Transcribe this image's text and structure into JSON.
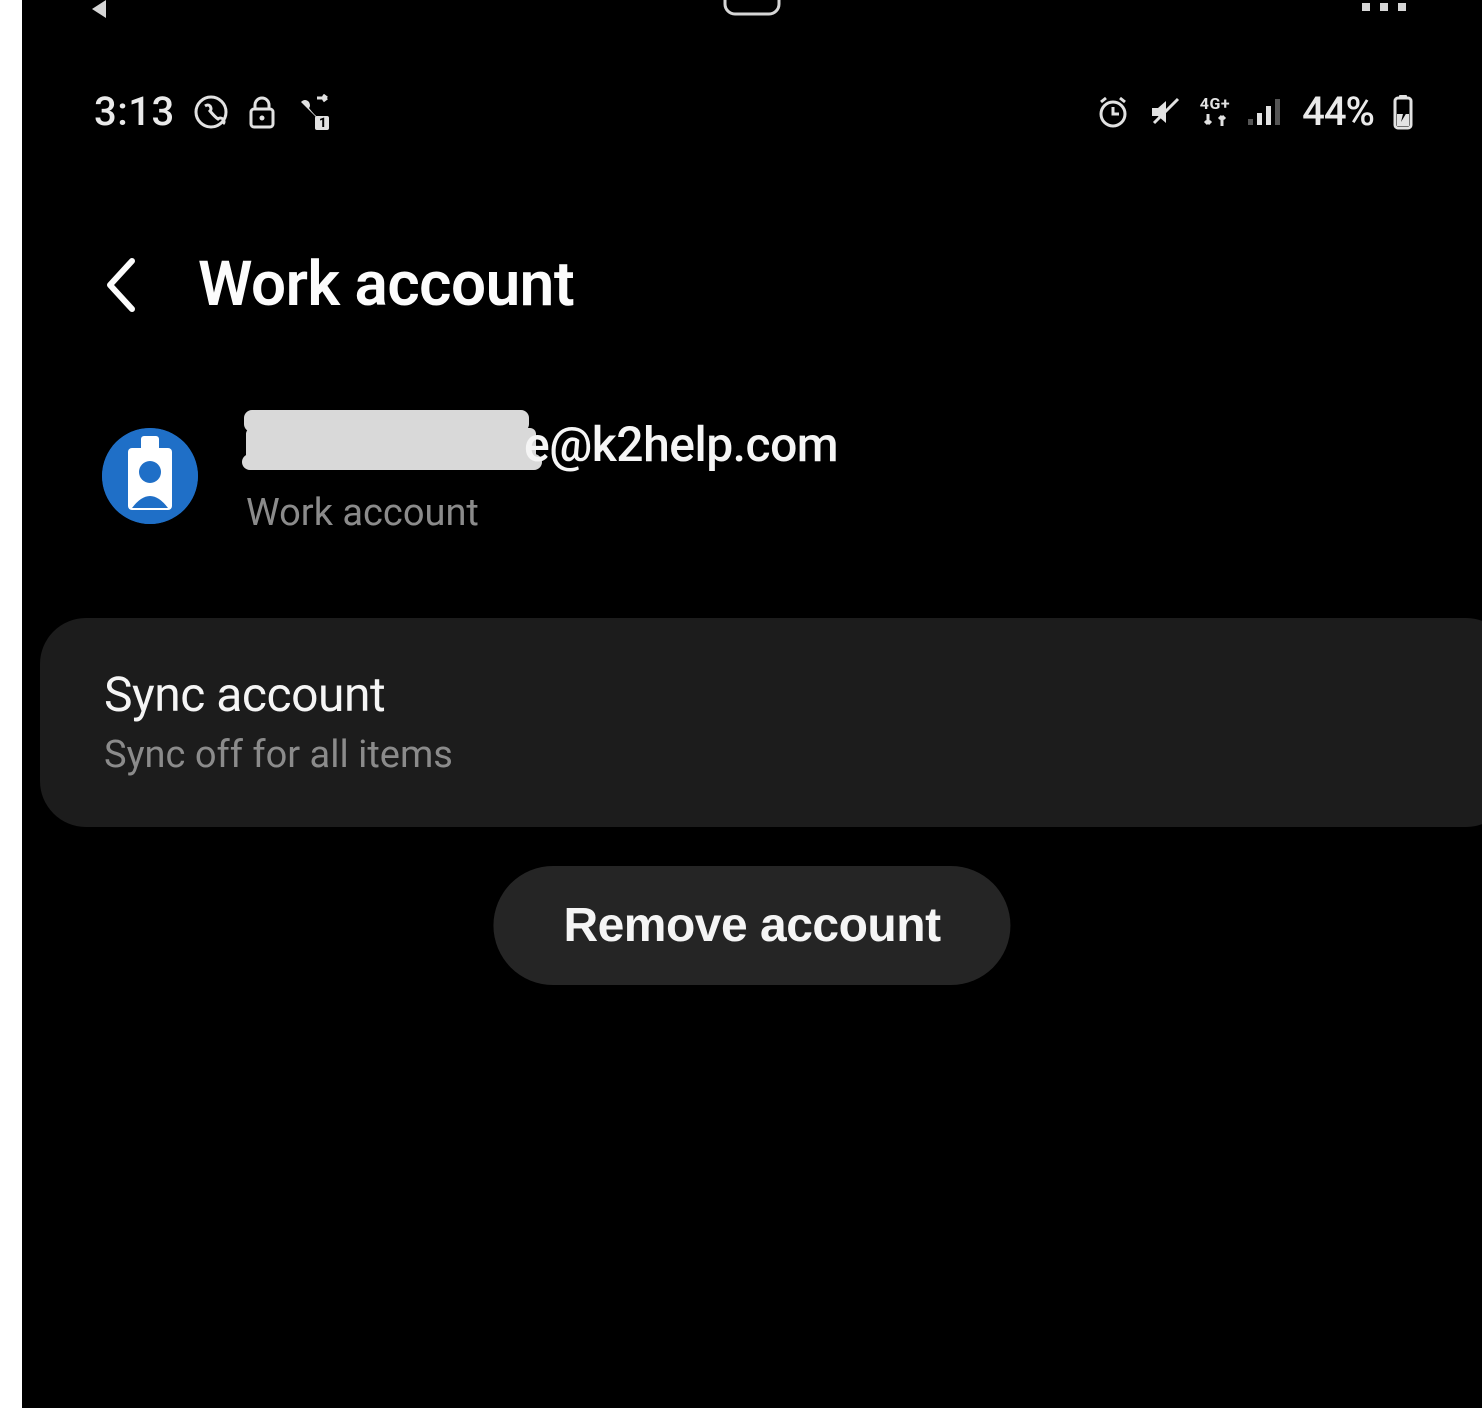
{
  "statusbar": {
    "time": "3:13",
    "network_label": "4G+",
    "battery_pct": "44%"
  },
  "header": {
    "title": "Work account"
  },
  "account": {
    "email_redacted_prefix": "",
    "email_visible_fragment": "e@k2help.com",
    "type_label": "Work account"
  },
  "sync": {
    "title": "Sync account",
    "subtitle": "Sync off for all items"
  },
  "buttons": {
    "remove": "Remove account"
  },
  "icons": {
    "back": "chevron-left",
    "viber": "viber",
    "lock": "lock",
    "call_fwd": "call-forward",
    "alarm": "alarm",
    "mute": "mute",
    "data": "mobile-data",
    "signal": "signal",
    "battery": "battery-charging",
    "id_badge": "id-badge"
  }
}
